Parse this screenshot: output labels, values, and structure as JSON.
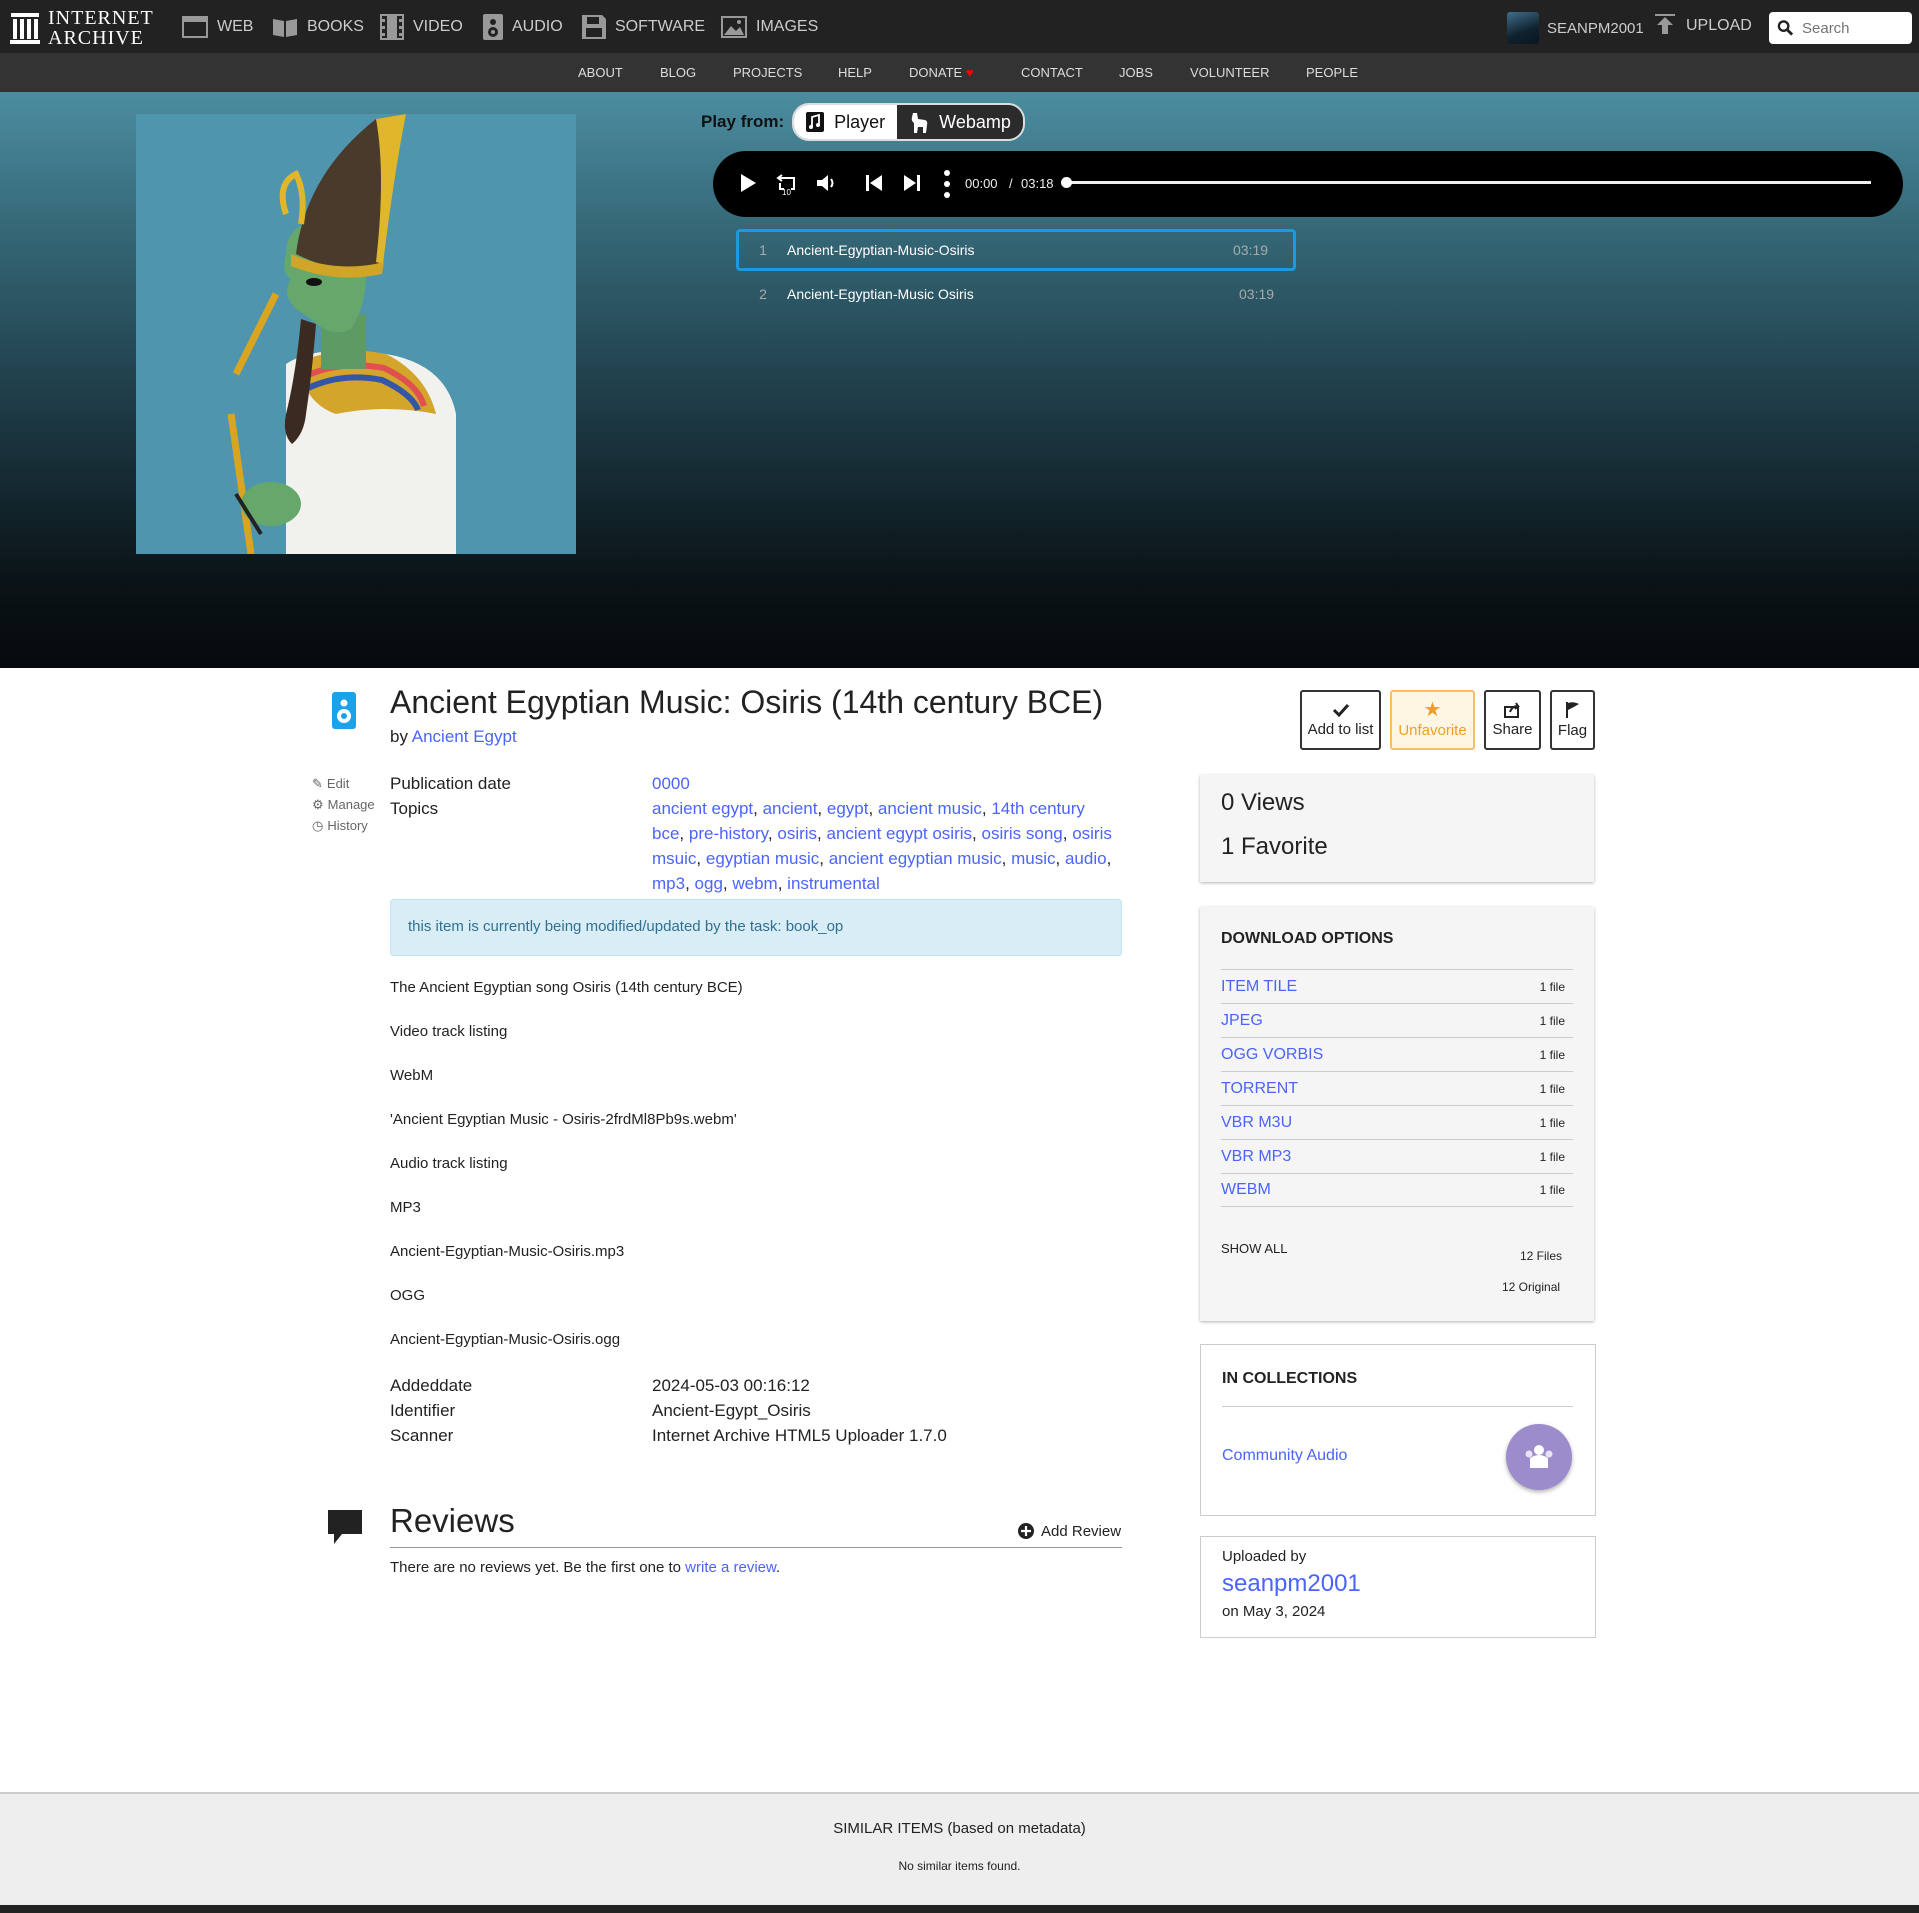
{
  "nav": {
    "logo_line1": "INTERNET",
    "logo_line2": "ARCHIVE",
    "media": [
      {
        "label": "WEB",
        "icon": "web-icon"
      },
      {
        "label": "BOOKS",
        "icon": "book-icon"
      },
      {
        "label": "VIDEO",
        "icon": "film-icon"
      },
      {
        "label": "AUDIO",
        "icon": "speaker-icon"
      },
      {
        "label": "SOFTWARE",
        "icon": "floppy-icon"
      },
      {
        "label": "IMAGES",
        "icon": "image-icon"
      }
    ],
    "username": "SEANPM2001",
    "upload": "UPLOAD",
    "search_placeholder": "Search"
  },
  "subnav": [
    "ABOUT",
    "BLOG",
    "PROJECTS",
    "HELP",
    "DONATE",
    "CONTACT",
    "JOBS",
    "VOLUNTEER",
    "PEOPLE"
  ],
  "player": {
    "play_from_label": "Play from:",
    "options": [
      "Player",
      "Webamp"
    ],
    "current_time": "00:00",
    "separator": "/",
    "total_time": "03:18",
    "progress": 0,
    "tracks": [
      {
        "num": "1",
        "name": "Ancient-Egyptian-Music-Osiris",
        "duration": "03:19"
      },
      {
        "num": "2",
        "name": "Ancient-Egyptian-Music Osiris",
        "duration": "03:19"
      }
    ]
  },
  "item": {
    "title": "Ancient Egyptian Music: Osiris (14th century BCE)",
    "by_prefix": "by",
    "creator": "Ancient Egypt",
    "side_links": [
      "Edit",
      "Manage",
      "History"
    ],
    "actions": [
      "Add to list",
      "Unfavorite",
      "Share",
      "Flag"
    ],
    "publication_date_label": "Publication date",
    "publication_date": "0000",
    "topics_label": "Topics",
    "topics": [
      "ancient egypt",
      "ancient",
      "egypt",
      "ancient music",
      "14th century bce",
      "pre-history",
      "osiris",
      "ancient egypt osiris",
      "osiris song",
      "osiris msuic",
      "egyptian music",
      "ancient egyptian music",
      "music",
      "audio",
      "mp3",
      "ogg",
      "webm",
      "instrumental"
    ],
    "notice": "this item is currently being modified/updated by the task: book_op",
    "description": [
      "The Ancient Egyptian song Osiris (14th century BCE)",
      "Video track listing",
      "WebM",
      "'Ancient Egyptian Music - Osiris-2frdMl8Pb9s.webm'",
      "Audio track listing",
      "MP3",
      "Ancient-Egyptian-Music-Osiris.mp3",
      "OGG",
      "Ancient-Egyptian-Music-Osiris.ogg"
    ],
    "addeddate_label": "Addeddate",
    "addeddate": "2024-05-03 00:16:12",
    "identifier_label": "Identifier",
    "identifier": "Ancient-Egypt_Osiris",
    "scanner_label": "Scanner",
    "scanner": "Internet Archive HTML5 Uploader 1.7.0"
  },
  "reviews": {
    "title": "Reviews",
    "add": "Add Review",
    "none_text": "There are no reviews yet. Be the first one to",
    "write_link": "write a review",
    "period": "."
  },
  "stats": {
    "views": "0 Views",
    "favorites": "1 Favorite"
  },
  "downloads": {
    "heading": "DOWNLOAD OPTIONS",
    "rows": [
      {
        "name": "ITEM TILE",
        "count": "1 file"
      },
      {
        "name": "JPEG",
        "count": "1 file"
      },
      {
        "name": "OGG VORBIS",
        "count": "1 file"
      },
      {
        "name": "TORRENT",
        "count": "1 file"
      },
      {
        "name": "VBR M3U",
        "count": "1 file"
      },
      {
        "name": "VBR MP3",
        "count": "1 file"
      },
      {
        "name": "WEBM",
        "count": "1 file"
      }
    ],
    "show_all": "SHOW ALL",
    "files": "12 Files",
    "original": "12 Original"
  },
  "collections": {
    "heading": "IN COLLECTIONS",
    "name": "Community Audio"
  },
  "uploader": {
    "label": "Uploaded by",
    "name": "seanpm2001",
    "date": "on May 3, 2024"
  },
  "similar": {
    "heading": "SIMILAR ITEMS (based on metadata)",
    "none": "No similar items found."
  },
  "colors": {
    "accent": "#4b64ff",
    "audio": "#1aa3e8",
    "favorite": "#fbbf5d",
    "collection": "#9d8ccc"
  }
}
